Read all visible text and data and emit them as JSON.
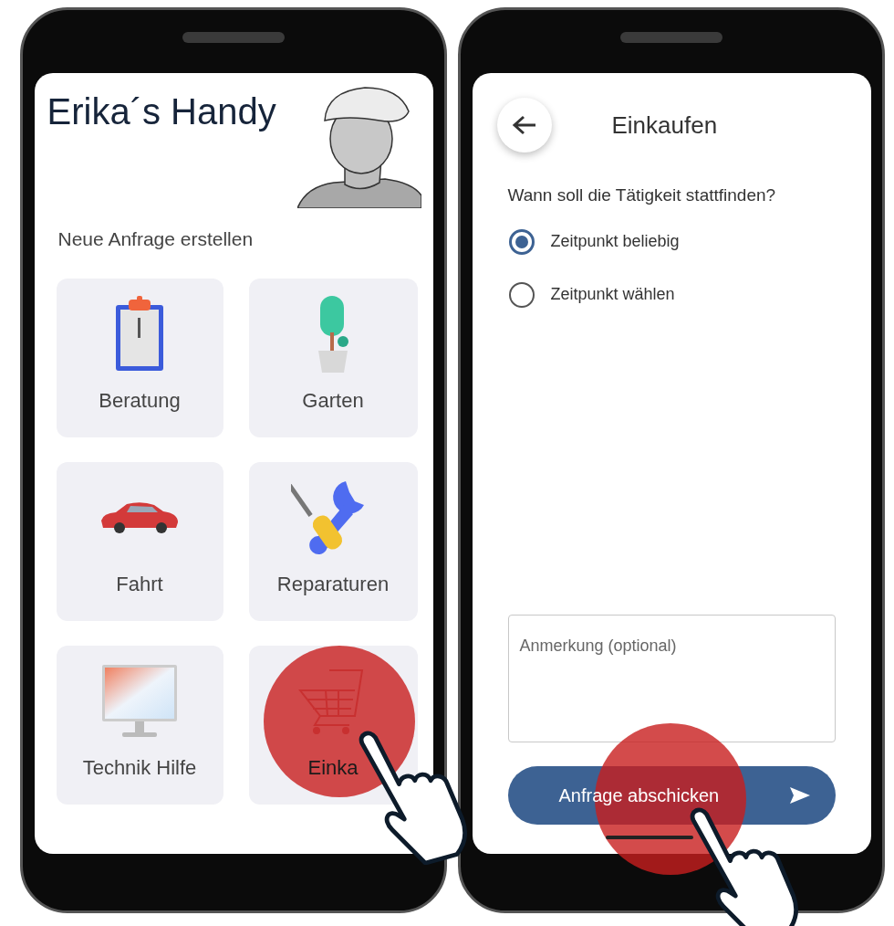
{
  "home_screen": {
    "title": "Erika´s Handy",
    "section_title": "Neue Anfrage erstellen",
    "tiles": [
      {
        "label": "Beratung",
        "kind": "clipboard",
        "tapped": false
      },
      {
        "label": "Garten",
        "kind": "plant",
        "tapped": false
      },
      {
        "label": "Fahrt",
        "kind": "car",
        "tapped": false
      },
      {
        "label": "Reparaturen",
        "kind": "tools",
        "tapped": false
      },
      {
        "label": "Technik Hilfe",
        "kind": "monitor",
        "tapped": false
      },
      {
        "label": "Einka",
        "kind": "cart",
        "tapped": true
      }
    ]
  },
  "request_screen": {
    "title": "Einkaufen",
    "question": "Wann soll die Tätigkeit stattfinden?",
    "options": [
      {
        "label": "Zeitpunkt beliebig",
        "selected": true
      },
      {
        "label": "Zeitpunkt wählen",
        "selected": false
      }
    ],
    "note_field": {
      "placeholder": "Anmerkung (optional)"
    },
    "submit_button": {
      "label": "Anfrage abschicken",
      "tapped": true
    }
  }
}
